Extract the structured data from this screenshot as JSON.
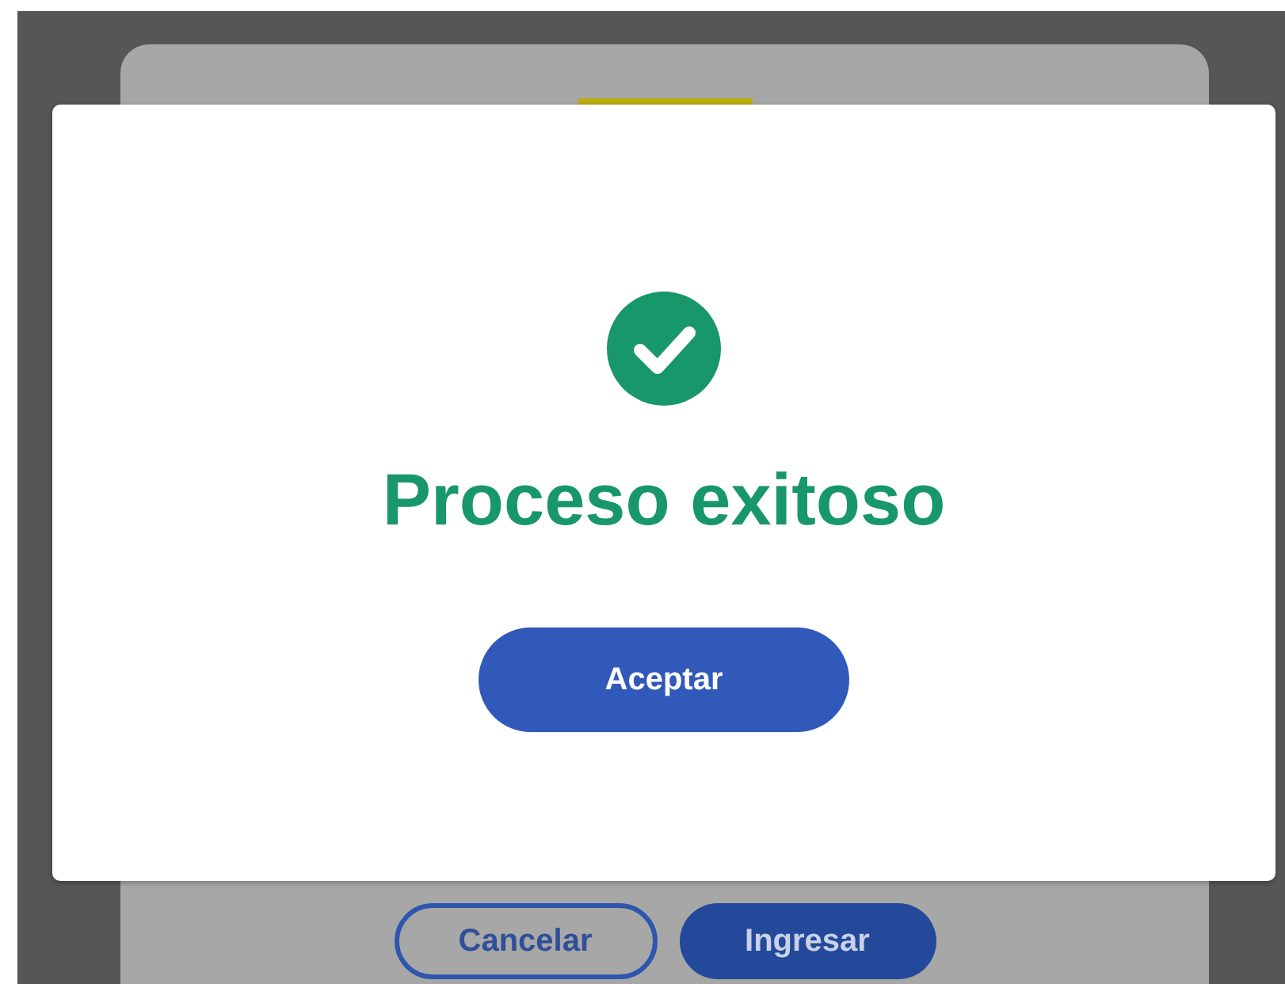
{
  "background_form": {
    "buttons": [
      {
        "label": "Cancelar",
        "kind": "outline"
      },
      {
        "label": "Ingresar",
        "kind": "filled"
      }
    ]
  },
  "dialog": {
    "kind": "success",
    "title": "Proceso exitoso",
    "button": "Aceptar"
  }
}
